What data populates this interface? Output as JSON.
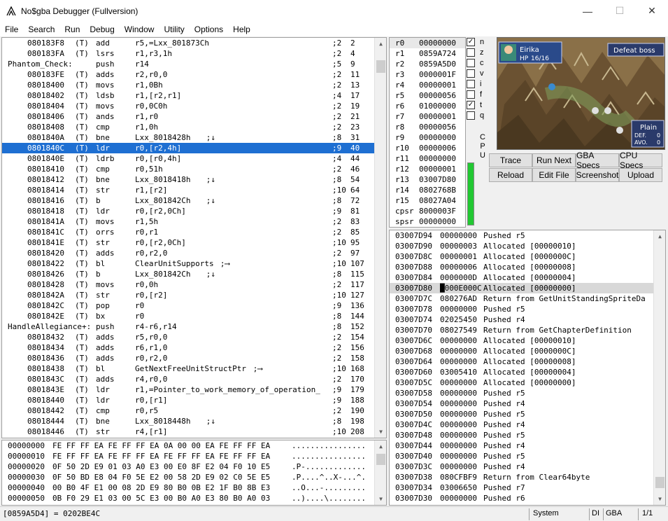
{
  "window": {
    "title": "No$gba Debugger (Fullversion)"
  },
  "menu": [
    "File",
    "Search",
    "Run",
    "Debug",
    "Window",
    "Utility",
    "Options",
    "Help"
  ],
  "disasm": [
    {
      "addr": "080183F8",
      "mode": "(T)",
      "op": "add",
      "args": "r5,=Lxx_801873Ch",
      "arrow": "",
      "cyc": ";2",
      "tot": "2"
    },
    {
      "addr": "080183FA",
      "mode": "(T)",
      "op": "lsrs",
      "args": "r1,r3,1h",
      "arrow": "",
      "cyc": ";2",
      "tot": "4"
    },
    {
      "label": "Phantom_Check:",
      "op": "push",
      "args": "r14",
      "arrow": "",
      "cyc": ";5",
      "tot": "9"
    },
    {
      "addr": "080183FE",
      "mode": "(T)",
      "op": "adds",
      "args": "r2,r0,0",
      "arrow": "",
      "cyc": ";2",
      "tot": "11"
    },
    {
      "addr": "08018400",
      "mode": "(T)",
      "op": "movs",
      "args": "r1,0Bh",
      "arrow": "",
      "cyc": ";2",
      "tot": "13"
    },
    {
      "addr": "08018402",
      "mode": "(T)",
      "op": "ldsb",
      "args": "r1,[r2,r1]",
      "arrow": "",
      "cyc": ";4",
      "tot": "17"
    },
    {
      "addr": "08018404",
      "mode": "(T)",
      "op": "movs",
      "args": "r0,0C0h",
      "arrow": "",
      "cyc": ";2",
      "tot": "19"
    },
    {
      "addr": "08018406",
      "mode": "(T)",
      "op": "ands",
      "args": "r1,r0",
      "arrow": "",
      "cyc": ";2",
      "tot": "21"
    },
    {
      "addr": "08018408",
      "mode": "(T)",
      "op": "cmp",
      "args": "r1,0h",
      "arrow": "",
      "cyc": ";2",
      "tot": "23"
    },
    {
      "addr": "0801840A",
      "mode": "(T)",
      "op": "bne",
      "args": "Lxx_8018428h",
      "arrow": ";↓",
      "cyc": ";8",
      "tot": "31"
    },
    {
      "addr": "0801840C",
      "mode": "(T)",
      "op": "ldr",
      "args": "r0,[r2,4h]",
      "arrow": "",
      "cyc": ";9",
      "tot": "40",
      "sel": true
    },
    {
      "addr": "0801840E",
      "mode": "(T)",
      "op": "ldrb",
      "args": "r0,[r0,4h]",
      "arrow": "",
      "cyc": ";4",
      "tot": "44"
    },
    {
      "addr": "08018410",
      "mode": "(T)",
      "op": "cmp",
      "args": "r0,51h",
      "arrow": "",
      "cyc": ";2",
      "tot": "46"
    },
    {
      "addr": "08018412",
      "mode": "(T)",
      "op": "bne",
      "args": "Lxx_8018418h",
      "arrow": ";↓",
      "cyc": ";8",
      "tot": "54"
    },
    {
      "addr": "08018414",
      "mode": "(T)",
      "op": "str",
      "args": "r1,[r2]",
      "arrow": "",
      "cyc": ";10",
      "tot": "64"
    },
    {
      "addr": "08018416",
      "mode": "(T)",
      "op": "b",
      "args": "Lxx_801842Ch",
      "arrow": ";↓",
      "cyc": ";8",
      "tot": "72"
    },
    {
      "addr": "08018418",
      "mode": "(T)",
      "op": "ldr",
      "args": "r0,[r2,0Ch]",
      "arrow": "",
      "cyc": ";9",
      "tot": "81"
    },
    {
      "addr": "0801841A",
      "mode": "(T)",
      "op": "movs",
      "args": "r1,5h",
      "arrow": "",
      "cyc": ";2",
      "tot": "83"
    },
    {
      "addr": "0801841C",
      "mode": "(T)",
      "op": "orrs",
      "args": "r0,r1",
      "arrow": "",
      "cyc": ";2",
      "tot": "85"
    },
    {
      "addr": "0801841E",
      "mode": "(T)",
      "op": "str",
      "args": "r0,[r2,0Ch]",
      "arrow": "",
      "cyc": ";10",
      "tot": "95"
    },
    {
      "addr": "08018420",
      "mode": "(T)",
      "op": "adds",
      "args": "r0,r2,0",
      "arrow": "",
      "cyc": ";2",
      "tot": "97"
    },
    {
      "addr": "08018422",
      "mode": "(T)",
      "op": "bl",
      "args": "ClearUnitSupports",
      "arrow": ";⟶",
      "cyc": ";10",
      "tot": "107"
    },
    {
      "addr": "08018426",
      "mode": "(T)",
      "op": "b",
      "args": "Lxx_801842Ch",
      "arrow": ";↓",
      "cyc": ";8",
      "tot": "115"
    },
    {
      "addr": "08018428",
      "mode": "(T)",
      "op": "movs",
      "args": "r0,0h",
      "arrow": "",
      "cyc": ";2",
      "tot": "117"
    },
    {
      "addr": "0801842A",
      "mode": "(T)",
      "op": "str",
      "args": "r0,[r2]",
      "arrow": "",
      "cyc": ";10",
      "tot": "127"
    },
    {
      "addr": "0801842C",
      "mode": "(T)",
      "op": "pop",
      "args": "r0",
      "arrow": "",
      "cyc": ";9",
      "tot": "136"
    },
    {
      "addr": "0801842E",
      "mode": "(T)",
      "op": "bx",
      "args": "r0",
      "arrow": "",
      "cyc": ";8",
      "tot": "144"
    },
    {
      "label": "HandleAllegiance+:",
      "op": "push",
      "args": "r4-r6,r14",
      "arrow": "",
      "cyc": ";8",
      "tot": "152"
    },
    {
      "addr": "08018432",
      "mode": "(T)",
      "op": "adds",
      "args": "r5,r0,0",
      "arrow": "",
      "cyc": ";2",
      "tot": "154"
    },
    {
      "addr": "08018434",
      "mode": "(T)",
      "op": "adds",
      "args": "r6,r1,0",
      "arrow": "",
      "cyc": ";2",
      "tot": "156"
    },
    {
      "addr": "08018436",
      "mode": "(T)",
      "op": "adds",
      "args": "r0,r2,0",
      "arrow": "",
      "cyc": ";2",
      "tot": "158"
    },
    {
      "addr": "08018438",
      "mode": "(T)",
      "op": "bl",
      "args": "GetNextFreeUnitStructPtr",
      "arrow": ";⟶",
      "cyc": ";10",
      "tot": "168"
    },
    {
      "addr": "0801843C",
      "mode": "(T)",
      "op": "adds",
      "args": "r4,r0,0",
      "arrow": "",
      "cyc": ";2",
      "tot": "170"
    },
    {
      "addr": "0801843E",
      "mode": "(T)",
      "op": "ldr",
      "args": "r1,=Pointer_to_work_memory_of_operation_",
      "arrow": "",
      "cyc": ";9",
      "tot": "179"
    },
    {
      "addr": "08018440",
      "mode": "(T)",
      "op": "ldr",
      "args": "r0,[r1]",
      "arrow": "",
      "cyc": ";9",
      "tot": "188"
    },
    {
      "addr": "08018442",
      "mode": "(T)",
      "op": "cmp",
      "args": "r0,r5",
      "arrow": "",
      "cyc": ";2",
      "tot": "190"
    },
    {
      "addr": "08018444",
      "mode": "(T)",
      "op": "bne",
      "args": "Lxx_8018448h",
      "arrow": ";↓",
      "cyc": ";8",
      "tot": "198"
    },
    {
      "addr": "08018446",
      "mode": "(T)",
      "op": "str",
      "args": "r4,[r1]",
      "arrow": "",
      "cyc": ";10",
      "tot": "208"
    }
  ],
  "hexdump": [
    {
      "addr": "00000000",
      "bytes": "FE FF FF EA FE FF FF EA 0A 00 00 EA FE FF FF EA",
      "ascii": "................"
    },
    {
      "addr": "00000010",
      "bytes": "FE FF FF EA FE FF FF EA FE FF FF EA FE FF FF EA",
      "ascii": "................"
    },
    {
      "addr": "00000020",
      "bytes": "0F 50 2D E9 01 03 A0 E3 00 E0 8F E2 04 F0 10 E5",
      "ascii": ".P-............."
    },
    {
      "addr": "00000030",
      "bytes": "0F 50 BD E8 04 F0 5E E2 00 58 2D E9 02 C0 5E E5",
      "ascii": ".P....^..X-...^."
    },
    {
      "addr": "00000040",
      "bytes": "00 B0 4F E1 00 08 2D E9 80 B0 0B E2 1F B0 8B E3",
      "ascii": "..O...-........."
    },
    {
      "addr": "00000050",
      "bytes": "0B F0 29 E1 03 00 5C E3 00 B0 A0 E3 80 B0 A0 03",
      "ascii": "..)....\\........"
    }
  ],
  "registers": [
    {
      "name": "r0",
      "value": "00000000",
      "sel": true
    },
    {
      "name": "r1",
      "value": "0859A724"
    },
    {
      "name": "r2",
      "value": "0859A5D0"
    },
    {
      "name": "r3",
      "value": "0000001F"
    },
    {
      "name": "r4",
      "value": "00000001"
    },
    {
      "name": "r5",
      "value": "00000056"
    },
    {
      "name": "r6",
      "value": "01000000"
    },
    {
      "name": "r7",
      "value": "00000001"
    },
    {
      "name": "r8",
      "value": "00000056"
    },
    {
      "name": "r9",
      "value": "00000000"
    },
    {
      "name": "r10",
      "value": "00000006"
    },
    {
      "name": "r11",
      "value": "00000000"
    },
    {
      "name": "r12",
      "value": "00000001"
    },
    {
      "name": "r13",
      "value": "03007D80"
    },
    {
      "name": "r14",
      "value": "0802768B"
    },
    {
      "name": "r15",
      "value": "08027A04"
    },
    {
      "name": "cpsr",
      "value": "8000003F"
    },
    {
      "name": "spsr",
      "value": "00000000"
    }
  ],
  "flags": [
    {
      "name": "n",
      "checked": true
    },
    {
      "name": "z",
      "checked": false
    },
    {
      "name": "c",
      "checked": false
    },
    {
      "name": "v",
      "checked": false
    },
    {
      "name": "i",
      "checked": false
    },
    {
      "name": "f",
      "checked": false
    },
    {
      "name": "t",
      "checked": true
    },
    {
      "name": "q",
      "checked": false
    }
  ],
  "cpu_label": "CPU",
  "game": {
    "unit_name": "Eirika",
    "hp_label": "HP",
    "hp": "16/16",
    "objective": "Defeat boss",
    "terrain": "Plain",
    "def_label": "DEF.",
    "def": "0",
    "avo_label": "AVO.",
    "avo": "0"
  },
  "buttons": [
    "Trace",
    "Run Next",
    "GBA Specs",
    "CPU Specs",
    "Reload",
    "Edit File",
    "Screenshot",
    "Upload"
  ],
  "stack": [
    {
      "addr": "03007D94",
      "val": "00000000",
      "desc": "Pushed r5"
    },
    {
      "addr": "03007D90",
      "val": "00000003",
      "desc": "Allocated [00000010]"
    },
    {
      "addr": "03007D8C",
      "val": "00000001",
      "desc": "Allocated [0000000C]"
    },
    {
      "addr": "03007D88",
      "val": "00000006",
      "desc": "Allocated [00000008]"
    },
    {
      "addr": "03007D84",
      "val": "0000000D",
      "desc": "Allocated [00000004]"
    },
    {
      "addr": "03007D80",
      "val": "█000E000C",
      "desc": "Allocated [00000000]",
      "sel": true
    },
    {
      "addr": "03007D7C",
      "val": "080276AD",
      "desc": "Return from GetUnitStandingSpriteDa"
    },
    {
      "addr": "03007D78",
      "val": "00000000",
      "desc": "Pushed r5"
    },
    {
      "addr": "03007D74",
      "val": "02025450",
      "desc": "Pushed r4"
    },
    {
      "addr": "03007D70",
      "val": "08027549",
      "desc": "Return from GetChapterDefinition"
    },
    {
      "addr": "03007D6C",
      "val": "00000000",
      "desc": "Allocated [00000010]"
    },
    {
      "addr": "03007D68",
      "val": "00000000",
      "desc": "Allocated [0000000C]"
    },
    {
      "addr": "03007D64",
      "val": "00000000",
      "desc": "Allocated [00000008]"
    },
    {
      "addr": "03007D60",
      "val": "03005410",
      "desc": "Allocated [00000004]"
    },
    {
      "addr": "03007D5C",
      "val": "00000000",
      "desc": "Allocated [00000000]"
    },
    {
      "addr": "03007D58",
      "val": "00000000",
      "desc": "Pushed r5"
    },
    {
      "addr": "03007D54",
      "val": "00000000",
      "desc": "Pushed r4"
    },
    {
      "addr": "03007D50",
      "val": "00000000",
      "desc": "Pushed r5"
    },
    {
      "addr": "03007D4C",
      "val": "00000000",
      "desc": "Pushed r4"
    },
    {
      "addr": "03007D48",
      "val": "00000000",
      "desc": "Pushed r5"
    },
    {
      "addr": "03007D44",
      "val": "00000000",
      "desc": "Pushed r4"
    },
    {
      "addr": "03007D40",
      "val": "00000000",
      "desc": "Pushed r5"
    },
    {
      "addr": "03007D3C",
      "val": "00000000",
      "desc": "Pushed r4"
    },
    {
      "addr": "03007D38",
      "val": "080CFBF9",
      "desc": "Return from Clear64byte"
    },
    {
      "addr": "03007D34",
      "val": "03006650",
      "desc": "Pushed r7"
    },
    {
      "addr": "03007D30",
      "val": "00000000",
      "desc": "Pushed r6"
    }
  ],
  "status": {
    "left": "[0859A5D4] = 0202BE4C",
    "system": "System",
    "di": "DI",
    "gba": "GBA",
    "page": "1/1"
  }
}
